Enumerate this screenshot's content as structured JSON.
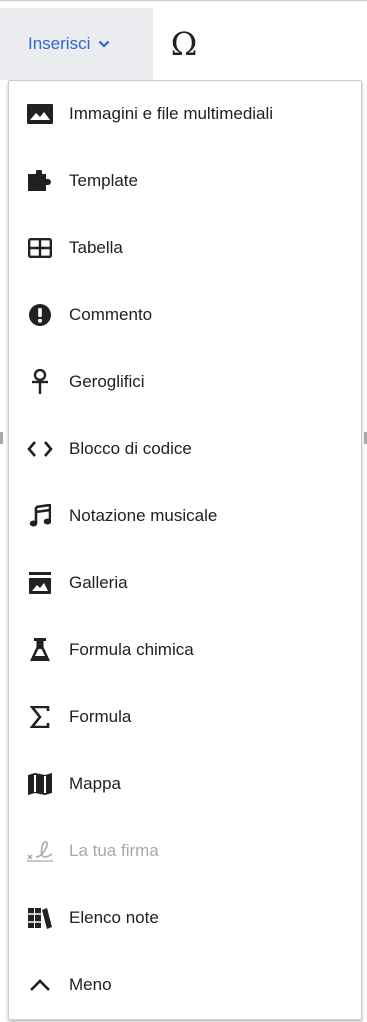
{
  "toolbar": {
    "insert_label": "Inserisci",
    "special_char_symbol": "Ω"
  },
  "menu": {
    "items": [
      {
        "label": "Immagini e file multimediali",
        "icon": "image-icon"
      },
      {
        "label": "Template",
        "icon": "puzzle-icon"
      },
      {
        "label": "Tabella",
        "icon": "table-icon"
      },
      {
        "label": "Commento",
        "icon": "alert-icon"
      },
      {
        "label": "Geroglifici",
        "icon": "ankh-icon"
      },
      {
        "label": "Blocco di codice",
        "icon": "code-icon"
      },
      {
        "label": "Notazione musicale",
        "icon": "music-icon"
      },
      {
        "label": "Galleria",
        "icon": "gallery-icon"
      },
      {
        "label": "Formula chimica",
        "icon": "flask-icon"
      },
      {
        "label": "Formula",
        "icon": "sigma-icon"
      },
      {
        "label": "Mappa",
        "icon": "map-icon"
      },
      {
        "label": "La tua firma",
        "icon": "signature-icon",
        "disabled": true
      },
      {
        "label": "Elenco note",
        "icon": "references-icon"
      },
      {
        "label": "Meno",
        "icon": "chevron-up-icon"
      }
    ]
  },
  "colors": {
    "accent": "#3366cc",
    "text": "#202122",
    "disabled": "#a2a9b1",
    "button_bg": "#eaecf0"
  }
}
